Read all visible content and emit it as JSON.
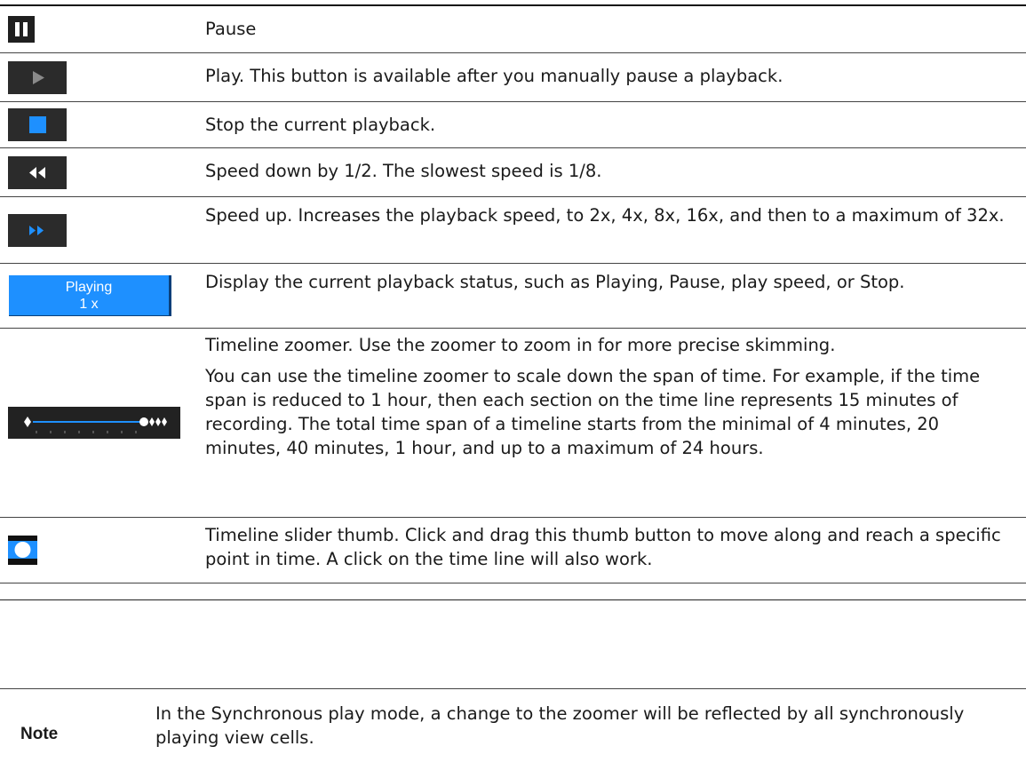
{
  "rows": [
    {
      "icon": "pause-icon",
      "text": "Pause"
    },
    {
      "icon": "play-icon",
      "text": "Play. This button is available after you manually pause a playback."
    },
    {
      "icon": "stop-icon",
      "text": "Stop the current playback."
    },
    {
      "icon": "rewind-icon",
      "text": "Speed down by 1/2. The slowest speed is 1/8."
    },
    {
      "icon": "fast-forward-icon",
      "text": "Speed up. Increases the playback speed, to 2x, 4x, 8x, 16x, and then to a maximum of 32x."
    },
    {
      "icon": "playback-status-indicator",
      "status_line1": "Playing",
      "status_line2": "1 x",
      "text": "Display the current playback status, such as Playing, Pause, play speed, or Stop."
    },
    {
      "icon": "timeline-zoomer-icon",
      "text": "Timeline zoomer. Use the zoomer to zoom in for more precise skimming.",
      "text2": "You can use the timeline zoomer to scale down the span of time. For example, if the time span is reduced to 1 hour, then each section on the time line represents 15 minutes of recording. The total time span of a timeline starts from the minimal of 4 minutes, 20 minutes, 40 minutes, 1 hour, and up to a maximum of 24 hours."
    },
    {
      "icon": "slider-thumb-icon",
      "text": "Timeline slider thumb. Click and drag this thumb button to move along and reach a specific point in time. A click on the time line will also work."
    }
  ],
  "note": {
    "label": "Note",
    "text": "In the Synchronous play mode, a change to the zoomer will be reflected by all synchronously playing view cells."
  },
  "colors": {
    "accent_blue": "#1e90ff",
    "dark_button": "#2b2b2b"
  }
}
